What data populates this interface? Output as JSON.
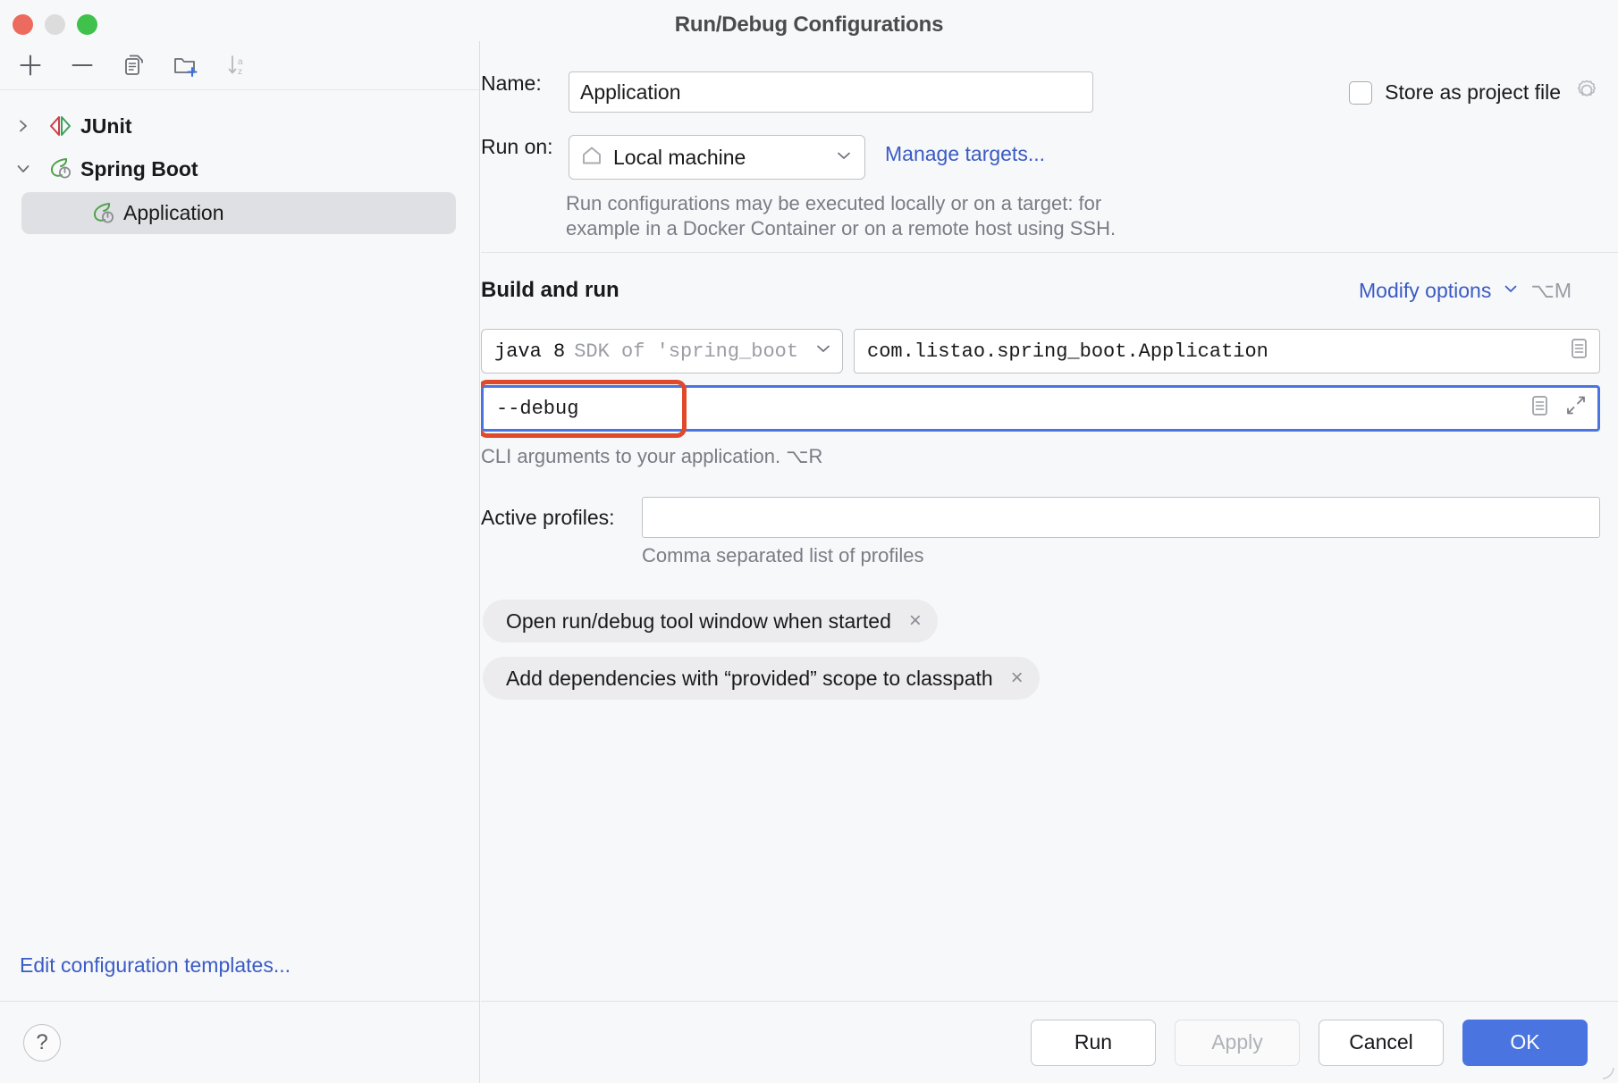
{
  "window": {
    "title": "Run/Debug Configurations",
    "traffic_lights": [
      "close",
      "minimize",
      "zoom"
    ]
  },
  "sidebar": {
    "toolbar": [
      {
        "name": "add-configuration-button",
        "icon": "plus-icon"
      },
      {
        "name": "remove-configuration-button",
        "icon": "minus-icon"
      },
      {
        "name": "copy-configuration-button",
        "icon": "copy-icon"
      },
      {
        "name": "new-folder-button",
        "icon": "folder-plus-icon"
      },
      {
        "name": "sort-configurations-button",
        "icon": "sort-az-icon"
      }
    ],
    "tree": [
      {
        "label": "JUnit",
        "icon": "junit-icon",
        "expanded": false,
        "level": 0,
        "selected": false
      },
      {
        "label": "Spring Boot",
        "icon": "spring-boot-icon",
        "expanded": true,
        "level": 0,
        "selected": false
      },
      {
        "label": "Application",
        "icon": "spring-boot-icon",
        "level": 1,
        "selected": true
      }
    ],
    "edit_templates_link": "Edit configuration templates...",
    "help_icon_label": "?"
  },
  "form": {
    "name_label": "Name:",
    "name_value": "Application",
    "name_placeholder": "",
    "store_as_project_file_label": "Store as project file",
    "store_as_project_file_checked": false,
    "store_gear_icon": "gear-icon",
    "run_on_label": "Run on:",
    "run_on_value": "Local machine",
    "run_on_icon": "home-icon",
    "manage_targets_link": "Manage targets...",
    "run_on_hint_line1": "Run configurations may be executed locally or on a target: for",
    "run_on_hint_line2": "example in a Docker Container or on a remote host using SSH.",
    "build_and_run_title": "Build and run",
    "modify_options_label": "Modify options",
    "modify_options_shortcut": "⌥M",
    "sdk_value_bold": "java 8",
    "sdk_value_dim": "SDK of 'spring_boot",
    "main_class_value": "com.listao.spring_boot.Application",
    "main_class_browse_icon": "list-document-icon",
    "program_args_value": "--debug",
    "program_args_placeholder": "",
    "program_args_browse_icon": "list-document-icon",
    "program_args_expand_icon": "expand-arrows-icon",
    "program_args_hint": "CLI arguments to your application. ⌥R",
    "active_profiles_label": "Active profiles:",
    "active_profiles_value": "",
    "active_profiles_hint": "Comma separated list of profiles",
    "chips": [
      {
        "label": "Open run/debug tool window when started",
        "close": "×"
      },
      {
        "label": "Add dependencies with “provided” scope to classpath",
        "close": "×"
      }
    ]
  },
  "buttons": {
    "run": "Run",
    "apply": "Apply",
    "apply_disabled": true,
    "cancel": "Cancel",
    "ok": "OK"
  },
  "colors": {
    "accent_blue": "#4a74e0",
    "link_blue": "#3b5bc4",
    "highlight_red": "#e04a2b",
    "window_bg": "#f7f8fa",
    "selected_row": "#dfe0e3",
    "muted_text": "#7a7c85"
  }
}
